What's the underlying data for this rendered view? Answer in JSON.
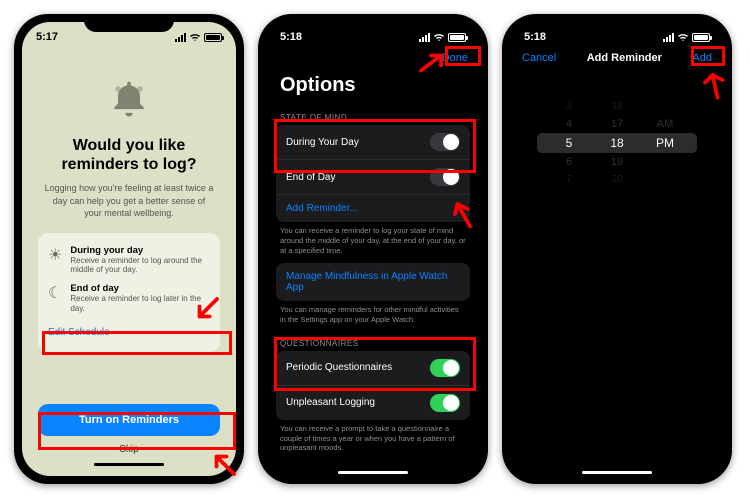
{
  "annotations": {
    "highlight_color": "#ff0000"
  },
  "screen1": {
    "time": "5:17",
    "heading": "Would you like reminders to log?",
    "subtext": "Logging how you're feeling at least twice a day can help you get a better sense of your mental wellbeing.",
    "item1": {
      "title": "During your day",
      "desc": "Receive a reminder to log around the middle of your day."
    },
    "item2": {
      "title": "End of day",
      "desc": "Receive a reminder to log later in the day."
    },
    "edit_schedule": "Edit Schedule",
    "primary_button": "Turn on Reminders",
    "skip": "Skip"
  },
  "screen2": {
    "time": "5:18",
    "done": "Done",
    "title": "Options",
    "section_state": "STATE OF MIND",
    "during_day": "During Your Day",
    "end_day": "End of Day",
    "add_reminder": "Add Reminder...",
    "state_footer": "You can receive a reminder to log your state of mind around the middle of your day, at the end of your day, or at a specified time.",
    "manage_watch": "Manage Mindfulness in Apple Watch App",
    "watch_footer": "You can manage reminders for other mindful activities in the Settings app on your Apple Watch.",
    "section_q": "QUESTIONNAIRES",
    "periodic": "Periodic Questionnaires",
    "unpleasant": "Unpleasant Logging",
    "q_footer": "You can receive a prompt to take a questionnaire a couple of times a year or when you have a pattern of unpleasant moods.",
    "toggles": {
      "during_day": false,
      "end_day": false,
      "periodic": true,
      "unpleasant": true
    }
  },
  "screen3": {
    "time": "5:18",
    "cancel": "Cancel",
    "title": "Add Reminder",
    "add": "Add",
    "picker": {
      "hour": "5",
      "minute": "18",
      "ampm": "PM",
      "hour_minus2": "3",
      "hour_minus1": "4",
      "hour_plus1": "6",
      "hour_plus2": "7",
      "min_minus2": "16",
      "min_minus1": "17",
      "min_plus1": "19",
      "min_plus2": "20",
      "am": "AM"
    }
  }
}
